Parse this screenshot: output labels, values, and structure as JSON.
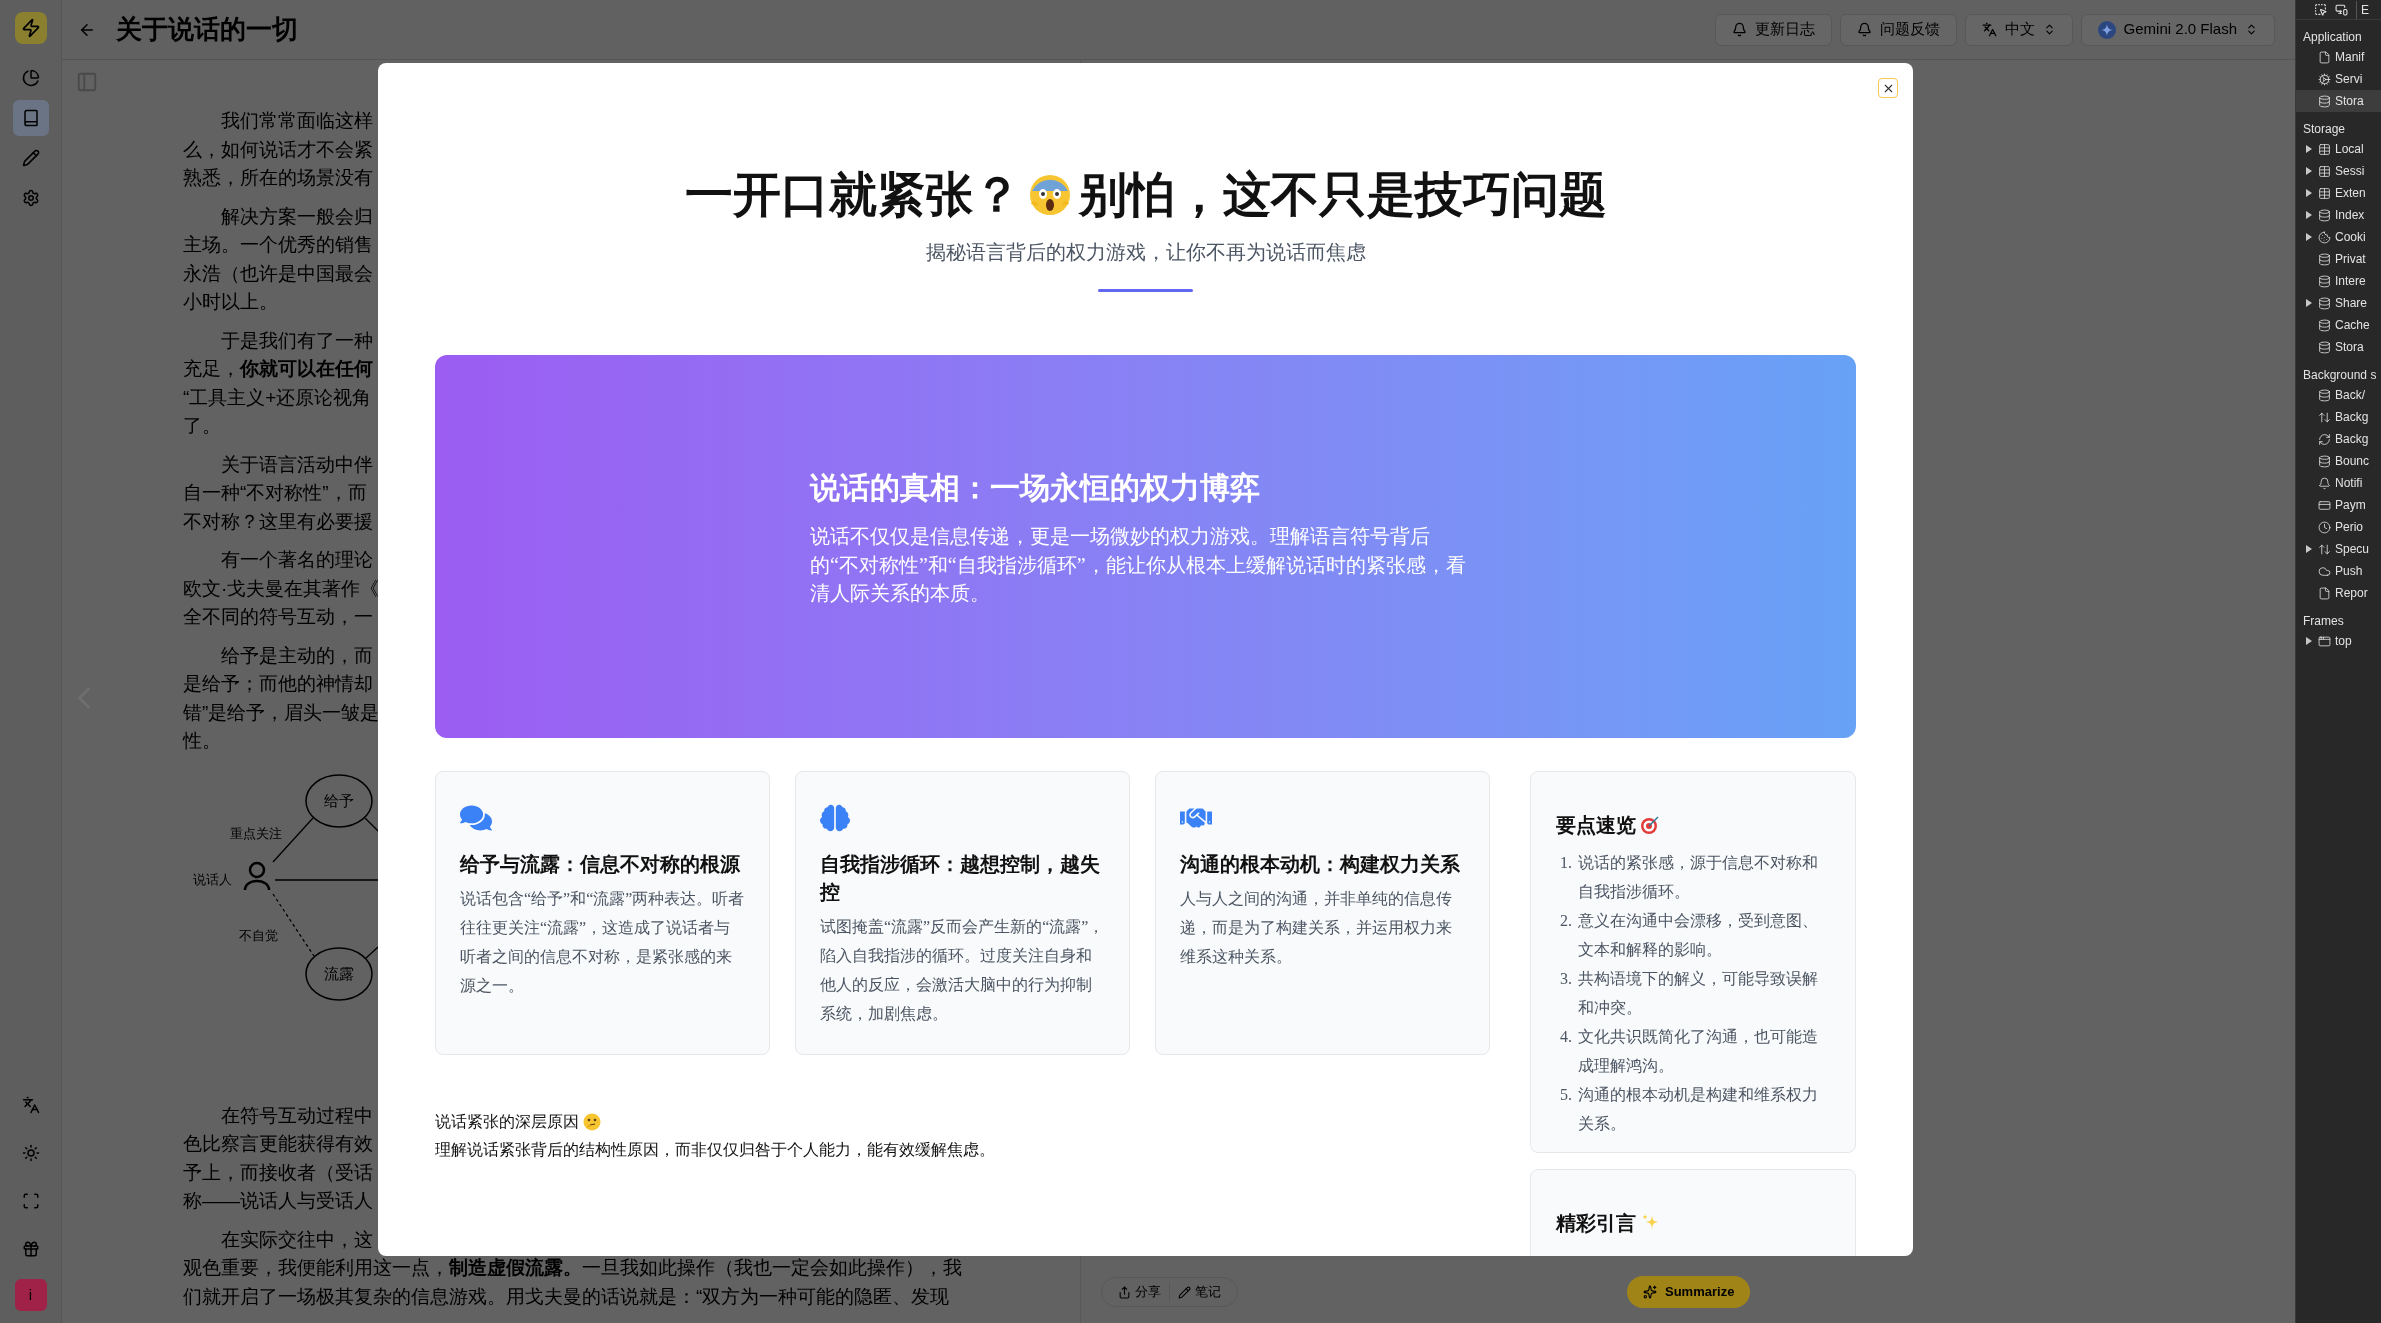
{
  "rail": {
    "items": [
      {
        "kind": "chart",
        "selected": false
      },
      {
        "kind": "book",
        "selected": true
      },
      {
        "kind": "pen",
        "selected": false
      },
      {
        "kind": "gear",
        "selected": false
      }
    ],
    "bottom": [
      {
        "kind": "translate"
      },
      {
        "kind": "sun"
      },
      {
        "kind": "expand"
      },
      {
        "kind": "gift"
      }
    ],
    "avatar": "i"
  },
  "header": {
    "title": "关于说话的一切",
    "buttons": [
      {
        "kind": "bell",
        "label": "更新日志"
      },
      {
        "kind": "bell",
        "label": "问题反馈"
      },
      {
        "kind": "language",
        "label": "中文"
      },
      {
        "kind": "model",
        "label": "Gemini 2.0 Flash"
      }
    ]
  },
  "article": {
    "paragraphs": [
      {
        "lines": [
          "我们常常面临这样",
          "么，如何说话才不会紧",
          "熟悉，所在的场景没有"
        ]
      },
      {
        "lines": [
          "解决方案一般会归",
          "主场。一个优秀的销售",
          "永浩（也许是中国最会",
          "小时以上。"
        ]
      },
      {
        "lines": [
          "于是我们有了一种",
          "充足，**你就可以在任何**",
          "“工具主义+还原论视角",
          "了。"
        ]
      },
      {
        "lines": [
          "关于语言活动中伴",
          "自一种“不对称性”，而",
          "不对称？这里有必要援"
        ]
      },
      {
        "lines": [
          "有一个著名的理论",
          "欧文·戈夫曼在其著作《",
          "全不同的符号互动，一"
        ]
      },
      {
        "lines": [
          "给予是主动的，而",
          "是给予；而他的神情却",
          "错”是给予，眉头一皱是",
          "性。"
        ]
      },
      {
        "lines": [
          "在符号互动过程中",
          "色比察言更能获得有效",
          "予上，而接收者（受话",
          "称——说话人与受话人"
        ]
      },
      {
        "lines": [
          "在实际交往中，这",
          "观色重要，我便能利用这一点，**制造虚假流露。**一旦我如此操作（我也一定会如此操作），我",
          "们就开启了一场极其复杂的信息游戏。用戈夫曼的话说就是：“双方为一种可能的隐匿、发现"
        ]
      }
    ],
    "diagram": {
      "nodes": [
        "给予",
        "流露"
      ],
      "speaker": "说话人",
      "labels": [
        "重点关注",
        "不自觉"
      ]
    }
  },
  "reader_toolbar": {
    "actions": [
      {
        "kind": "share",
        "label": "分享"
      },
      {
        "kind": "note",
        "label": "笔记"
      }
    ],
    "summarize": "Summarize"
  },
  "modal": {
    "title": [
      "一开口就紧张？",
      "别怕，这不只是技巧问题"
    ],
    "subtitle": "揭秘语言背后的权力游戏，让你不再为说话而焦虑",
    "hero": {
      "title": "说话的真相：一场永恒的权力博弈",
      "text": "说话不仅仅是信息传递，更是一场微妙的权力游戏。理解语言符号背后的“不对称性”和“自我指涉循环”，能让你从根本上缓解说话时的紧张感，看清人际关系的本质。"
    },
    "cards": [
      {
        "kind": "chat",
        "title": "给予与流露：信息不对称的根源",
        "text": "说话包含“给予”和“流露”两种表达。听者往往更关注“流露”，这造成了说话者与听者之间的信息不对称，是紧张感的来源之一。"
      },
      {
        "kind": "brain",
        "title": "自我指涉循环：越想控制，越失控",
        "text": "试图掩盖“流露”反而会产生新的“流露”，陷入自我指涉的循环。过度关注自身和他人的反应，会激活大脑中的行为抑制系统，加剧焦虑。"
      },
      {
        "kind": "handshake",
        "title": "沟通的根本动机：构建权力关系",
        "text": "人与人之间的沟通，并非单纯的信息传递，而是为了构建关系，并运用权力来维系这种关系。"
      }
    ],
    "insight": {
      "title": "说话紧张的深层原因",
      "text": "理解说话紧张背后的结构性原因，而非仅仅归咎于个人能力，能有效缓解焦虑。"
    },
    "summary": {
      "title": "要点速览",
      "items": [
        {
          "number": "1.",
          "text": "说话的紧张感，源于信息不对称和自我指涉循环。"
        },
        {
          "number": "2.",
          "text": "意义在沟通中会漂移，受到意图、文本和解释的影响。"
        },
        {
          "number": "3.",
          "text": "共构语境下的解义，可能导致误解和冲突。"
        },
        {
          "number": "4.",
          "text": "文化共识既简化了沟通，也可能造成理解鸿沟。"
        },
        {
          "number": "5.",
          "text": "沟通的根本动机是构建和维系权力关系。"
        }
      ]
    },
    "quotes": {
      "title": "精彩引言"
    }
  },
  "devtools": {
    "toolbar_text": "E",
    "sections": [
      {
        "title": "Application",
        "items": [
          {
            "label": "Manif",
            "kind": "file",
            "expandable": false,
            "selected": false
          },
          {
            "label": "Servi",
            "kind": "gears",
            "expandable": false,
            "selected": false
          },
          {
            "label": "Stora",
            "kind": "database",
            "expandable": false,
            "selected": true
          }
        ]
      },
      {
        "title": "Storage",
        "items": [
          {
            "label": "Local",
            "kind": "table",
            "expandable": true,
            "selected": false
          },
          {
            "label": "Sessi",
            "kind": "table",
            "expandable": true,
            "selected": false
          },
          {
            "label": "Exten",
            "kind": "table",
            "expandable": true,
            "selected": false
          },
          {
            "label": "Index",
            "kind": "database",
            "expandable": true,
            "selected": false
          },
          {
            "label": "Cooki",
            "kind": "cookie",
            "expandable": true,
            "selected": false
          },
          {
            "label": "Privat",
            "kind": "database",
            "expandable": false,
            "selected": false
          },
          {
            "label": "Intere",
            "kind": "database",
            "expandable": false,
            "selected": false
          },
          {
            "label": "Share",
            "kind": "database",
            "expandable": true,
            "selected": false
          },
          {
            "label": "Cache",
            "kind": "database",
            "expandable": false,
            "selected": false
          },
          {
            "label": "Stora",
            "kind": "database",
            "expandable": false,
            "selected": false
          }
        ]
      },
      {
        "title": "Background s",
        "items": [
          {
            "label": "Back/",
            "kind": "database",
            "expandable": false,
            "selected": false
          },
          {
            "label": "Backg",
            "kind": "arrows",
            "expandable": false,
            "selected": false
          },
          {
            "label": "Backg",
            "kind": "sync",
            "expandable": false,
            "selected": false
          },
          {
            "label": "Bounc",
            "kind": "database",
            "expandable": false,
            "selected": false
          },
          {
            "label": "Notifi",
            "kind": "bell",
            "expandable": false,
            "selected": false
          },
          {
            "label": "Paym",
            "kind": "card",
            "expandable": false,
            "selected": false
          },
          {
            "label": "Perio",
            "kind": "clock",
            "expandable": false,
            "selected": false
          },
          {
            "label": "Specu",
            "kind": "arrows",
            "expandable": true,
            "selected": false
          },
          {
            "label": "Push",
            "kind": "cloud",
            "expandable": false,
            "selected": false
          },
          {
            "label": "Repor",
            "kind": "file",
            "expandable": false,
            "selected": false
          }
        ]
      },
      {
        "title": "Frames",
        "items": [
          {
            "label": "top",
            "kind": "window",
            "expandable": true,
            "selected": false
          }
        ]
      }
    ]
  }
}
